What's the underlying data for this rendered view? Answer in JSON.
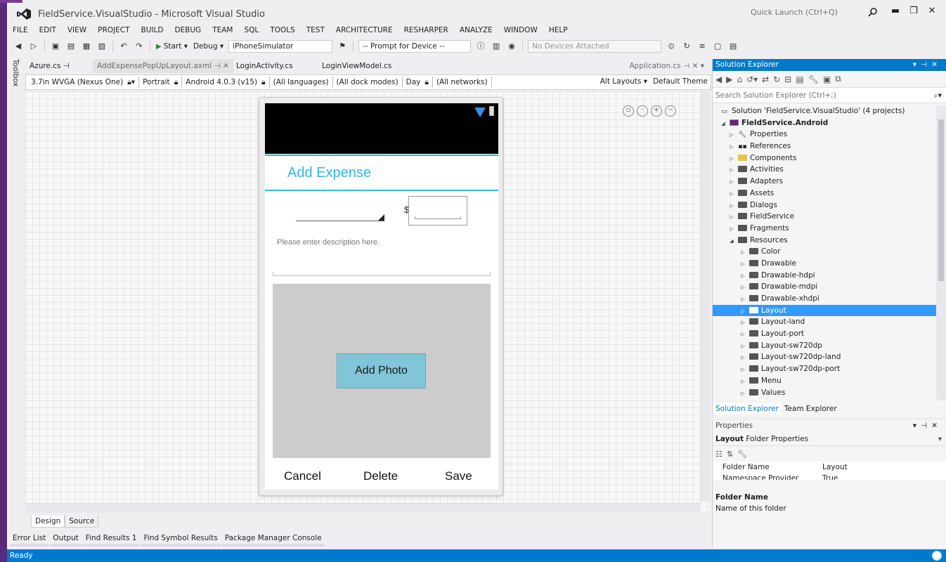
{
  "window": {
    "title": "FieldService.VisualStudio - Microsoft Visual Studio",
    "quick_launch_placeholder": "Quick Launch (Ctrl+Q)",
    "minimize_glyph": "▬",
    "restore_glyph": "❐",
    "close_glyph": "✕"
  },
  "menu": [
    "FILE",
    "EDIT",
    "VIEW",
    "PROJECT",
    "BUILD",
    "DEBUG",
    "TEAM",
    "SQL",
    "TOOLS",
    "TEST",
    "ARCHITECTURE",
    "RESHARPER",
    "ANALYZE",
    "WINDOW",
    "HELP"
  ],
  "toolbar": {
    "start_label": "Start",
    "config": "Debug",
    "platform": "iPhoneSimulator",
    "prompt_device": "-- Prompt for Device --",
    "devices": "No Devices Attached"
  },
  "toolbox_label": "Toolbox",
  "doc_tabs": {
    "tab1": "Azure.cs",
    "tab2": "AddExpensePopUpLayout.axml",
    "tab3": "LoginActivity.cs",
    "tab4": "LoginViewModel.cs",
    "right": "Application.cs"
  },
  "config_bar": {
    "device": "3.7in WVGA (Nexus One)",
    "orientation": "Portrait",
    "api": "Android 4.0.3 (v15)",
    "languages": "(All languages)",
    "dock": "(All dock modes)",
    "daynight": "Day",
    "networks": "(All networks)",
    "alt_layouts": "Alt Layouts ▾",
    "theme": "Default Theme"
  },
  "phone": {
    "title": "Add Expense",
    "currency": "$",
    "description_hint": "Please enter description here.",
    "add_photo": "Add Photo",
    "cancel": "Cancel",
    "delete": "Delete",
    "save": "Save"
  },
  "design_tabs": {
    "design": "Design",
    "source": "Source"
  },
  "bottom_tabs": [
    "Error List",
    "Output",
    "Find Results 1",
    "Find Symbol Results",
    "Package Manager Console"
  ],
  "status": {
    "text": "Ready"
  },
  "solution_explorer": {
    "title": "Solution Explorer",
    "search_placeholder": "Search Solution Explorer (Ctrl+;)",
    "solution": "Solution 'FieldService.VisualStudio' (4 projects)",
    "project": "FieldService.Android",
    "items": [
      "Properties",
      "References",
      "Components",
      "Activities",
      "Adapters",
      "Assets",
      "Dialogs",
      "FieldService",
      "Fragments",
      "Resources"
    ],
    "resources": [
      "Color",
      "Drawable",
      "Drawable-hdpi",
      "Drawable-mdpi",
      "Drawable-xhdpi",
      "Layout",
      "Layout-land",
      "Layout-port",
      "Layout-sw720dp",
      "Layout-sw720dp-land",
      "Layout-sw720dp-port",
      "Menu",
      "Values"
    ],
    "selected": "Layout",
    "tab_se": "Solution Explorer",
    "tab_te": "Team Explorer"
  },
  "properties": {
    "title": "Properties",
    "selection_name": "Layout",
    "selection_type": "Folder Properties",
    "rows": [
      {
        "name": "Folder Name",
        "value": "Layout"
      },
      {
        "name": "Namespace Provider",
        "value": "True"
      }
    ],
    "desc_title": "Folder Name",
    "desc_text": "Name of this folder"
  },
  "colors": {
    "accent": "#007acc",
    "android_blue": "#33b5e5",
    "photo_button": "#83c5d8",
    "selection": "#3399ff"
  }
}
